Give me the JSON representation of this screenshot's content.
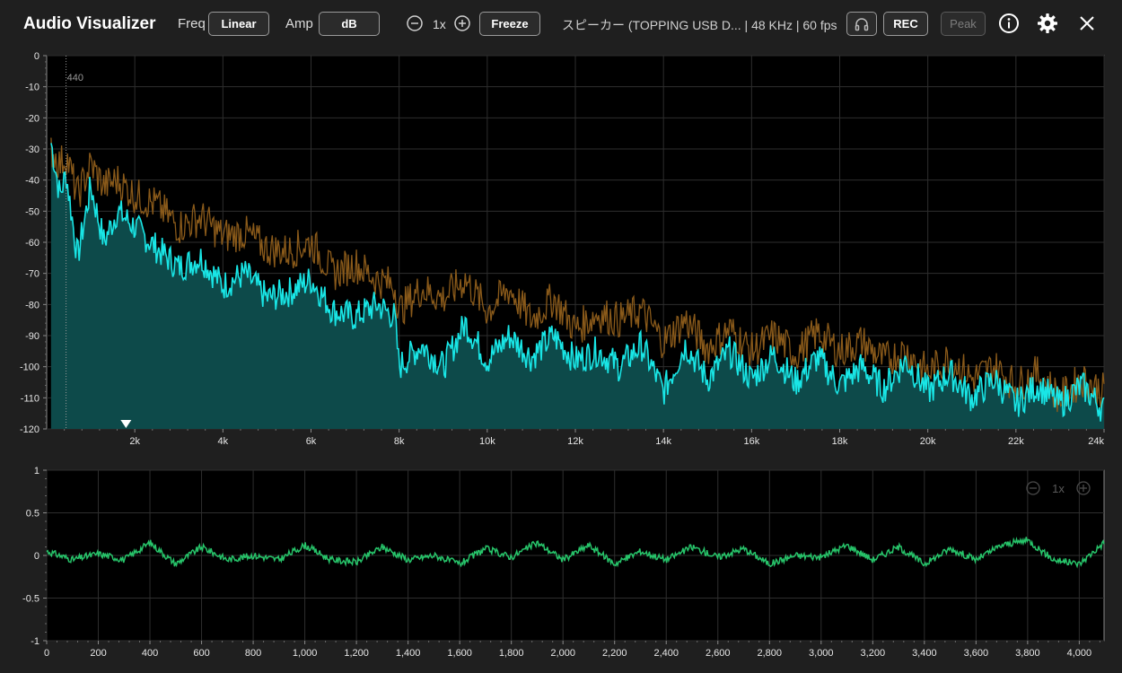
{
  "app": {
    "title": "Audio Visualizer"
  },
  "toolbar": {
    "freq_label": "Freq",
    "freq_value": "Linear",
    "amp_label": "Amp",
    "amp_value": "dB",
    "zoom_value": "1x",
    "freeze_label": "Freeze",
    "device_text": "スピーカー (TOPPING USB D... | 48 KHz | 60 fps",
    "rec_label": "REC",
    "peak_label": "Peak",
    "icons": [
      "zoom-out-icon",
      "zoom-in-icon",
      "headphones-icon",
      "info-icon",
      "gear-icon",
      "close-icon"
    ]
  },
  "colors": {
    "spectrum_line": "#19e6e6",
    "spectrum_fill": "#0d4a4a",
    "peak_line": "#8a5a1a",
    "waveform_line": "#27c46a",
    "plot_background": "#000000",
    "app_background": "#1f1f1f"
  },
  "chart_data": [
    {
      "type": "area",
      "name": "spectrum",
      "x_unit": "Hz",
      "x_tick_labels": [
        "2k",
        "4k",
        "6k",
        "8k",
        "10k",
        "12k",
        "14k",
        "16k",
        "18k",
        "20k",
        "22k",
        "24k"
      ],
      "y_tick_labels": [
        "0",
        "-10",
        "-20",
        "-30",
        "-40",
        "-50",
        "-60",
        "-70",
        "-80",
        "-90",
        "-100",
        "-110",
        "-120"
      ],
      "xlim": [
        0,
        24000
      ],
      "ylim": [
        -120,
        0
      ],
      "grid": true,
      "marker": {
        "label": "440",
        "x": 440
      },
      "cursor": {
        "x": 1800
      },
      "series": [
        {
          "role": "current",
          "x": [
            100,
            300,
            440,
            700,
            1000,
            1300,
            1600,
            2000,
            2500,
            3000,
            3500,
            4000,
            4500,
            5000,
            5500,
            6000,
            6500,
            7000,
            7500,
            7900,
            8000,
            8500,
            9000,
            9500,
            10000,
            10500,
            11000,
            11500,
            12000,
            12500,
            13000,
            13500,
            14000,
            14500,
            15000,
            15500,
            16000,
            16500,
            17000,
            17500,
            18000,
            18500,
            19000,
            19500,
            20000,
            20500,
            21000,
            21500,
            22000,
            22500,
            23000,
            23500,
            24000
          ],
          "values": [
            -28,
            -45,
            -38,
            -65,
            -42,
            -60,
            -50,
            -55,
            -62,
            -68,
            -65,
            -74,
            -70,
            -78,
            -76,
            -72,
            -82,
            -84,
            -80,
            -84,
            -100,
            -93,
            -100,
            -86,
            -98,
            -90,
            -97,
            -90,
            -98,
            -95,
            -100,
            -93,
            -108,
            -93,
            -104,
            -95,
            -104,
            -96,
            -105,
            -97,
            -106,
            -100,
            -107,
            -98,
            -108,
            -102,
            -110,
            -104,
            -112,
            -106,
            -112,
            -106,
            -114
          ]
        },
        {
          "role": "peak-hold",
          "x": [
            100,
            300,
            440,
            700,
            1000,
            1300,
            1600,
            2000,
            2500,
            3000,
            3500,
            4000,
            4500,
            5000,
            5500,
            6000,
            6500,
            7000,
            7500,
            7900,
            8000,
            8500,
            9000,
            9500,
            10000,
            10500,
            11000,
            11500,
            12000,
            12500,
            13000,
            13500,
            14000,
            14500,
            15000,
            15500,
            16000,
            16500,
            17000,
            17500,
            18000,
            18500,
            19000,
            19500,
            20000,
            20500,
            21000,
            21500,
            22000,
            22500,
            23000,
            23500,
            24000
          ],
          "values": [
            -30,
            -35,
            -32,
            -45,
            -35,
            -42,
            -40,
            -45,
            -48,
            -55,
            -52,
            -58,
            -57,
            -62,
            -63,
            -60,
            -70,
            -67,
            -72,
            -74,
            -82,
            -75,
            -78,
            -72,
            -82,
            -75,
            -85,
            -78,
            -88,
            -83,
            -85,
            -82,
            -92,
            -85,
            -94,
            -88,
            -95,
            -90,
            -96,
            -89,
            -95,
            -92,
            -98,
            -95,
            -102,
            -97,
            -104,
            -100,
            -106,
            -102,
            -110,
            -104,
            -108
          ]
        }
      ]
    },
    {
      "type": "line",
      "name": "waveform",
      "x_tick_labels": [
        "0",
        "200",
        "400",
        "600",
        "800",
        "1,000",
        "1,200",
        "1,400",
        "1,600",
        "1,800",
        "2,000",
        "2,200",
        "2,400",
        "2,600",
        "2,800",
        "3,000",
        "3,200",
        "3,400",
        "3,600",
        "3,800",
        "4,000"
      ],
      "y_tick_labels": [
        "1",
        "0.5",
        "0",
        "-0.5",
        "-1"
      ],
      "xlim": [
        0,
        4096
      ],
      "ylim": [
        -1,
        1
      ],
      "grid": true,
      "zoom_value": "1x",
      "series": [
        {
          "x": [
            0,
            100,
            200,
            300,
            400,
            500,
            600,
            700,
            800,
            900,
            1000,
            1100,
            1200,
            1300,
            1400,
            1500,
            1600,
            1700,
            1800,
            1900,
            2000,
            2100,
            2200,
            2300,
            2400,
            2500,
            2600,
            2700,
            2800,
            2900,
            3000,
            3100,
            3200,
            3300,
            3400,
            3500,
            3600,
            3700,
            3800,
            3900,
            4000,
            4096
          ],
          "values": [
            0.05,
            -0.05,
            0.02,
            -0.05,
            0.15,
            -0.1,
            0.1,
            -0.05,
            0.0,
            -0.05,
            0.12,
            -0.05,
            -0.08,
            0.1,
            -0.05,
            0.0,
            -0.1,
            0.08,
            -0.02,
            0.15,
            -0.05,
            0.12,
            -0.1,
            0.05,
            -0.05,
            0.1,
            -0.02,
            0.08,
            -0.1,
            0.0,
            -0.02,
            0.12,
            -0.05,
            0.1,
            -0.1,
            0.08,
            -0.05,
            0.12,
            0.18,
            -0.05,
            -0.1,
            0.15
          ]
        }
      ]
    }
  ]
}
